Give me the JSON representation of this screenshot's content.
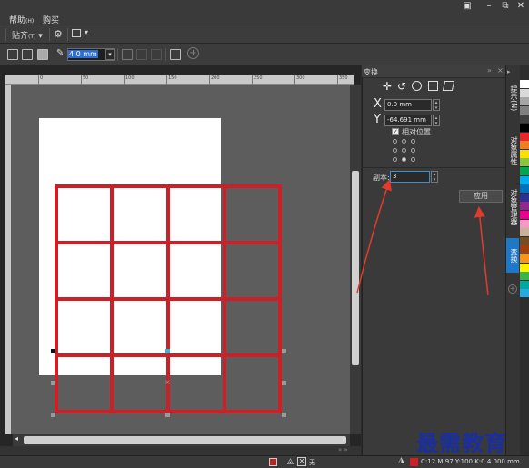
{
  "menu": {
    "help": "帮助",
    "help_key": "(H)",
    "buy": "购买"
  },
  "window_controls": {
    "restore_icon": "▣",
    "minimize": "–",
    "maximize": "⧉",
    "close": "✕"
  },
  "toolbar": {
    "snap_label": "贴齐",
    "snap_key": "(T)",
    "size_value": "4.0 mm"
  },
  "ruler_marks": [
    "0",
    "50",
    "100",
    "150",
    "200",
    "250",
    "300",
    "350"
  ],
  "docker": {
    "title": "变换",
    "x_label": "X",
    "x_value": "0.0 mm",
    "y_label": "Y",
    "y_value": "-64.691 mm",
    "relative_position": "相对位置",
    "copies_label": "副本:",
    "copies_value": "3",
    "apply_button": "应用"
  },
  "side_tabs": [
    "提示(N)",
    "对象属性",
    "对象管理器",
    "变换"
  ],
  "status": {
    "fill_text": "无",
    "color_info": "C:12 M:97 Y:100 K:0 4.000 mm"
  },
  "watermark": "最需教育",
  "colors": {
    "grid_red": "#cc1f26",
    "accent_blue": "#1e78c8",
    "apply_arrow": "#e23b2e"
  }
}
